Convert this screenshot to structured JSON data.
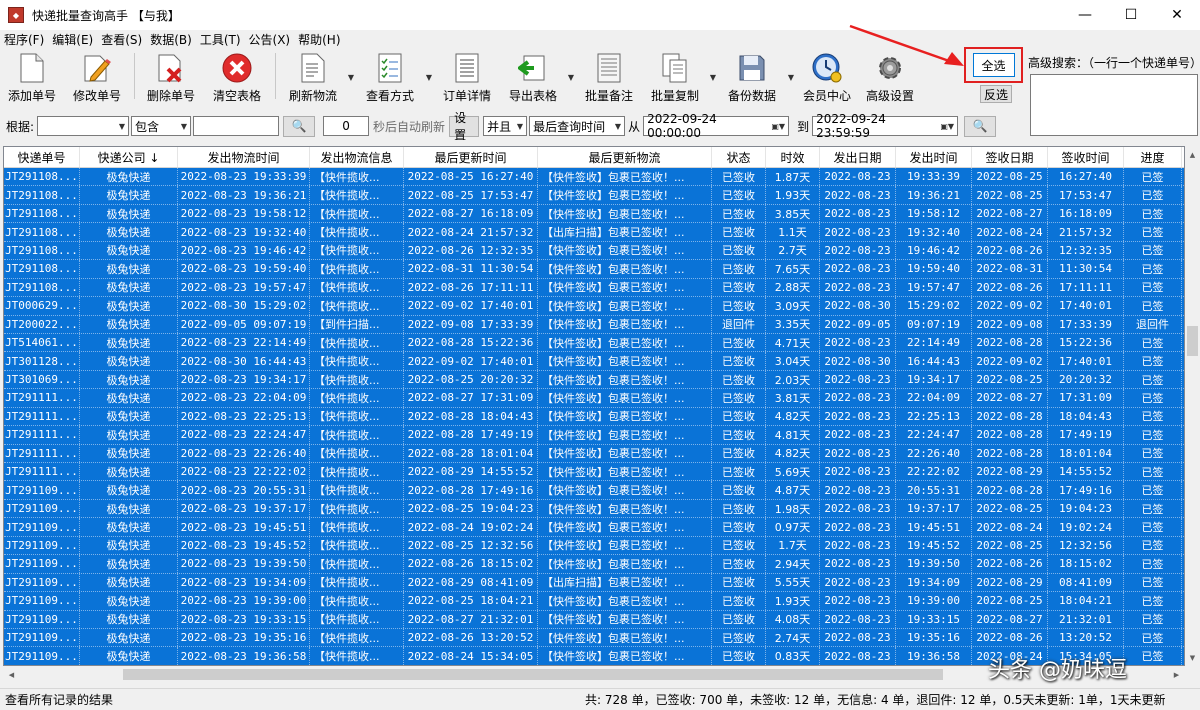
{
  "window": {
    "title": "快递批量查询高手 【与我】",
    "minimize": "—",
    "maximize": "☐",
    "close": "✕"
  },
  "menu": [
    "程序(F)",
    "编辑(E)",
    "查看(S)",
    "数据(B)",
    "工具(T)",
    "公告(X)",
    "帮助(H)"
  ],
  "toolbar": {
    "add": "添加单号",
    "edit": "修改单号",
    "delete": "删除单号",
    "clear": "清空表格",
    "refresh": "刷新物流",
    "view_mode": "查看方式",
    "order_detail": "订单详情",
    "export": "导出表格",
    "batch_note": "批量备注",
    "batch_copy": "批量复制",
    "backup": "备份数据",
    "member": "会员中心",
    "advanced": "高级设置",
    "select_all": "全选",
    "invert": "反选",
    "adv_search_label": "高级搜索：（一行一个快递单号）"
  },
  "filter": {
    "by_label": "根据:",
    "field_value": "",
    "match_value": "包含",
    "keyword": "",
    "seconds": "0",
    "auto_refresh": "秒后自动刷新",
    "settings_btn": "设置",
    "logic": "并且",
    "date_field": "最后查询时间",
    "from_label": "从",
    "from_date": "2022-09-24 00:00:00",
    "to_label": "到",
    "to_date": "2022-09-24 23:59:59"
  },
  "table": {
    "columns": [
      "快递单号",
      "快递公司 ↓",
      "发出物流时间",
      "发出物流信息",
      "最后更新时间",
      "最后更新物流",
      "状态",
      "时效",
      "发出日期",
      "发出时间",
      "签收日期",
      "签收时间",
      "进度"
    ],
    "rows": [
      [
        "JT291108...",
        "极兔快递",
        "2022-08-23 19:33:39",
        "【快件揽收...",
        "2022-08-25 16:27:40",
        "【快件签收】包裹已签收！...",
        "已签收",
        "1.87天",
        "2022-08-23",
        "19:33:39",
        "2022-08-25",
        "16:27:40",
        "已签"
      ],
      [
        "JT291108...",
        "极兔快递",
        "2022-08-23 19:36:21",
        "【快件揽收...",
        "2022-08-25 17:53:47",
        "【快件签收】包裹已签收！...",
        "已签收",
        "1.93天",
        "2022-08-23",
        "19:36:21",
        "2022-08-25",
        "17:53:47",
        "已签"
      ],
      [
        "JT291108...",
        "极兔快递",
        "2022-08-23 19:58:12",
        "【快件揽收...",
        "2022-08-27 16:18:09",
        "【快件签收】包裹已签收！...",
        "已签收",
        "3.85天",
        "2022-08-23",
        "19:58:12",
        "2022-08-27",
        "16:18:09",
        "已签"
      ],
      [
        "JT291108...",
        "极兔快递",
        "2022-08-23 19:32:40",
        "【快件揽收...",
        "2022-08-24 21:57:32",
        "【出库扫描】包裹已签收！...",
        "已签收",
        "1.1天",
        "2022-08-23",
        "19:32:40",
        "2022-08-24",
        "21:57:32",
        "已签"
      ],
      [
        "JT291108...",
        "极兔快递",
        "2022-08-23 19:46:42",
        "【快件揽收...",
        "2022-08-26 12:32:35",
        "【快件签收】包裹已签收！...",
        "已签收",
        "2.7天",
        "2022-08-23",
        "19:46:42",
        "2022-08-26",
        "12:32:35",
        "已签"
      ],
      [
        "JT291108...",
        "极兔快递",
        "2022-08-23 19:59:40",
        "【快件揽收...",
        "2022-08-31 11:30:54",
        "【快件签收】包裹已签收！...",
        "已签收",
        "7.65天",
        "2022-08-23",
        "19:59:40",
        "2022-08-31",
        "11:30:54",
        "已签"
      ],
      [
        "JT291108...",
        "极兔快递",
        "2022-08-23 19:57:47",
        "【快件揽收...",
        "2022-08-26 17:11:11",
        "【快件签收】包裹已签收！...",
        "已签收",
        "2.88天",
        "2022-08-23",
        "19:57:47",
        "2022-08-26",
        "17:11:11",
        "已签"
      ],
      [
        "JT000629...",
        "极兔快递",
        "2022-08-30 15:29:02",
        "【快件揽收...",
        "2022-09-02 17:40:01",
        "【快件签收】包裹已签收！...",
        "已签收",
        "3.09天",
        "2022-08-30",
        "15:29:02",
        "2022-09-02",
        "17:40:01",
        "已签"
      ],
      [
        "JT200022...",
        "极兔快递",
        "2022-09-05 09:07:19",
        "【到件扫描...",
        "2022-09-08 17:33:39",
        "【快件签收】包裹已签收！...",
        "退回件",
        "3.35天",
        "2022-09-05",
        "09:07:19",
        "2022-09-08",
        "17:33:39",
        "退回件"
      ],
      [
        "JT514061...",
        "极兔快递",
        "2022-08-23 22:14:49",
        "【快件揽收...",
        "2022-08-28 15:22:36",
        "【快件签收】包裹已签收！...",
        "已签收",
        "4.71天",
        "2022-08-23",
        "22:14:49",
        "2022-08-28",
        "15:22:36",
        "已签"
      ],
      [
        "JT301128...",
        "极兔快递",
        "2022-08-30 16:44:43",
        "【快件揽收...",
        "2022-09-02 17:40:01",
        "【快件签收】包裹已签收！...",
        "已签收",
        "3.04天",
        "2022-08-30",
        "16:44:43",
        "2022-09-02",
        "17:40:01",
        "已签"
      ],
      [
        "JT301069...",
        "极兔快递",
        "2022-08-23 19:34:17",
        "【快件揽收...",
        "2022-08-25 20:20:32",
        "【快件签收】包裹已签收！...",
        "已签收",
        "2.03天",
        "2022-08-23",
        "19:34:17",
        "2022-08-25",
        "20:20:32",
        "已签"
      ],
      [
        "JT291111...",
        "极兔快递",
        "2022-08-23 22:04:09",
        "【快件揽收...",
        "2022-08-27 17:31:09",
        "【快件签收】包裹已签收！...",
        "已签收",
        "3.81天",
        "2022-08-23",
        "22:04:09",
        "2022-08-27",
        "17:31:09",
        "已签"
      ],
      [
        "JT291111...",
        "极兔快递",
        "2022-08-23 22:25:13",
        "【快件揽收...",
        "2022-08-28 18:04:43",
        "【快件签收】包裹已签收！...",
        "已签收",
        "4.82天",
        "2022-08-23",
        "22:25:13",
        "2022-08-28",
        "18:04:43",
        "已签"
      ],
      [
        "JT291111...",
        "极兔快递",
        "2022-08-23 22:24:47",
        "【快件揽收...",
        "2022-08-28 17:49:19",
        "【快件签收】包裹已签收！...",
        "已签收",
        "4.81天",
        "2022-08-23",
        "22:24:47",
        "2022-08-28",
        "17:49:19",
        "已签"
      ],
      [
        "JT291111...",
        "极兔快递",
        "2022-08-23 22:26:40",
        "【快件揽收...",
        "2022-08-28 18:01:04",
        "【快件签收】包裹已签收！...",
        "已签收",
        "4.82天",
        "2022-08-23",
        "22:26:40",
        "2022-08-28",
        "18:01:04",
        "已签"
      ],
      [
        "JT291111...",
        "极兔快递",
        "2022-08-23 22:22:02",
        "【快件揽收...",
        "2022-08-29 14:55:52",
        "【快件签收】包裹已签收！...",
        "已签收",
        "5.69天",
        "2022-08-23",
        "22:22:02",
        "2022-08-29",
        "14:55:52",
        "已签"
      ],
      [
        "JT291109...",
        "极兔快递",
        "2022-08-23 20:55:31",
        "【快件揽收...",
        "2022-08-28 17:49:16",
        "【快件签收】包裹已签收！...",
        "已签收",
        "4.87天",
        "2022-08-23",
        "20:55:31",
        "2022-08-28",
        "17:49:16",
        "已签"
      ],
      [
        "JT291109...",
        "极兔快递",
        "2022-08-23 19:37:17",
        "【快件揽收...",
        "2022-08-25 19:04:23",
        "【快件签收】包裹已签收！...",
        "已签收",
        "1.98天",
        "2022-08-23",
        "19:37:17",
        "2022-08-25",
        "19:04:23",
        "已签"
      ],
      [
        "JT291109...",
        "极兔快递",
        "2022-08-23 19:45:51",
        "【快件揽收...",
        "2022-08-24 19:02:24",
        "【快件签收】包裹已签收！...",
        "已签收",
        "0.97天",
        "2022-08-23",
        "19:45:51",
        "2022-08-24",
        "19:02:24",
        "已签"
      ],
      [
        "JT291109...",
        "极兔快递",
        "2022-08-23 19:45:52",
        "【快件揽收...",
        "2022-08-25 12:32:56",
        "【快件签收】包裹已签收！...",
        "已签收",
        "1.7天",
        "2022-08-23",
        "19:45:52",
        "2022-08-25",
        "12:32:56",
        "已签"
      ],
      [
        "JT291109...",
        "极兔快递",
        "2022-08-23 19:39:50",
        "【快件揽收...",
        "2022-08-26 18:15:02",
        "【快件签收】包裹已签收！...",
        "已签收",
        "2.94天",
        "2022-08-23",
        "19:39:50",
        "2022-08-26",
        "18:15:02",
        "已签"
      ],
      [
        "JT291109...",
        "极兔快递",
        "2022-08-23 19:34:09",
        "【快件揽收...",
        "2022-08-29 08:41:09",
        "【出库扫描】包裹已签收！...",
        "已签收",
        "5.55天",
        "2022-08-23",
        "19:34:09",
        "2022-08-29",
        "08:41:09",
        "已签"
      ],
      [
        "JT291109...",
        "极兔快递",
        "2022-08-23 19:39:00",
        "【快件揽收...",
        "2022-08-25 18:04:21",
        "【快件签收】包裹已签收！...",
        "已签收",
        "1.93天",
        "2022-08-23",
        "19:39:00",
        "2022-08-25",
        "18:04:21",
        "已签"
      ],
      [
        "JT291109...",
        "极兔快递",
        "2022-08-23 19:33:15",
        "【快件揽收...",
        "2022-08-27 21:32:01",
        "【快件签收】包裹已签收！...",
        "已签收",
        "4.08天",
        "2022-08-23",
        "19:33:15",
        "2022-08-27",
        "21:32:01",
        "已签"
      ],
      [
        "JT291109...",
        "极兔快递",
        "2022-08-23 19:35:16",
        "【快件揽收...",
        "2022-08-26 13:20:52",
        "【快件签收】包裹已签收！...",
        "已签收",
        "2.74天",
        "2022-08-23",
        "19:35:16",
        "2022-08-26",
        "13:20:52",
        "已签"
      ],
      [
        "JT291109...",
        "极兔快递",
        "2022-08-23 19:36:58",
        "【快件揽收...",
        "2022-08-24 15:34:05",
        "【快件签收】包裹已签收！...",
        "已签收",
        "0.83天",
        "2022-08-23",
        "19:36:58",
        "2022-08-24",
        "15:34:05",
        "已签"
      ]
    ]
  },
  "status": {
    "left": "查看所有记录的结果",
    "right": "共: 728 单，已签收: 700 单，未签收: 12 单，无信息: 4 单，退回件: 12 单，0.5天未更新: 1单，1天未更新"
  },
  "watermark": "头条 @奶味逗"
}
